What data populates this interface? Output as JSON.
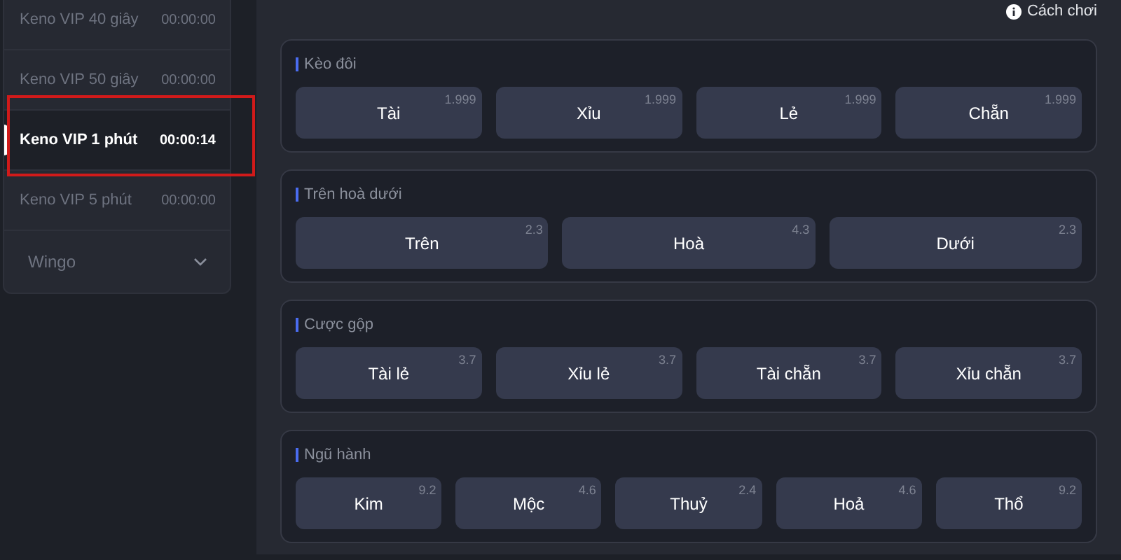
{
  "sidebar": {
    "items": [
      {
        "label": "Keno VIP 40 giây",
        "time": "00:00:00",
        "selected": false,
        "highlighted": false
      },
      {
        "label": "Keno VIP 50 giây",
        "time": "00:00:00",
        "selected": false,
        "highlighted": false
      },
      {
        "label": "Keno VIP 1 phút",
        "time": "00:00:14",
        "selected": true,
        "highlighted": true
      },
      {
        "label": "Keno VIP 5 phút",
        "time": "00:00:00",
        "selected": false,
        "highlighted": false
      }
    ],
    "group": {
      "label": "Wingo",
      "expanded": false
    }
  },
  "help_link": "Cách chơi",
  "sections": [
    {
      "title": "Kèo đôi",
      "options": [
        {
          "label": "Tài",
          "odds": "1.999"
        },
        {
          "label": "Xỉu",
          "odds": "1.999"
        },
        {
          "label": "Lẻ",
          "odds": "1.999"
        },
        {
          "label": "Chẵn",
          "odds": "1.999"
        }
      ]
    },
    {
      "title": "Trên hoà dưới",
      "options": [
        {
          "label": "Trên",
          "odds": "2.3"
        },
        {
          "label": "Hoà",
          "odds": "4.3"
        },
        {
          "label": "Dưới",
          "odds": "2.3"
        }
      ]
    },
    {
      "title": "Cược gộp",
      "options": [
        {
          "label": "Tài lẻ",
          "odds": "3.7"
        },
        {
          "label": "Xỉu lẻ",
          "odds": "3.7"
        },
        {
          "label": "Tài chẵn",
          "odds": "3.7"
        },
        {
          "label": "Xỉu chẵn",
          "odds": "3.7"
        }
      ]
    },
    {
      "title": "Ngũ hành",
      "options": [
        {
          "label": "Kim",
          "odds": "9.2"
        },
        {
          "label": "Mộc",
          "odds": "4.6"
        },
        {
          "label": "Thuỷ",
          "odds": "2.4"
        },
        {
          "label": "Hoả",
          "odds": "4.6"
        },
        {
          "label": "Thổ",
          "odds": "9.2"
        }
      ]
    }
  ]
}
